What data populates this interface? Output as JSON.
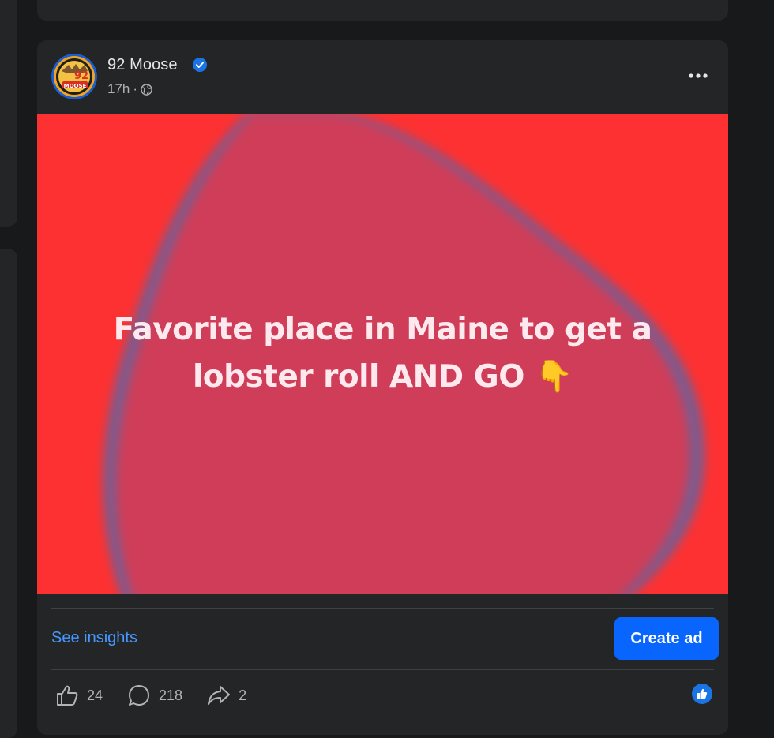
{
  "post": {
    "page_name": "92 Moose",
    "avatar_text": "92",
    "avatar_subtext": "MOOSE",
    "timestamp": "17h",
    "separator": "·",
    "audience_icon": "globe-icon",
    "more_icon": "more-horizontal-icon",
    "text_line1": "Favorite place in Maine to get a",
    "text_line2": "lobster roll AND GO 👇",
    "background_color": "#fd3131",
    "blob_color": "#cf3e58"
  },
  "actions": {
    "insights_label": "See insights",
    "create_ad_label": "Create ad"
  },
  "stats": {
    "likes": "24",
    "comments": "218",
    "shares": "2",
    "reaction_icon": "like-reaction-icon"
  },
  "colors": {
    "page_bg": "#18191a",
    "card_bg": "#242526",
    "link": "#4599ff",
    "button": "#0866ff"
  }
}
